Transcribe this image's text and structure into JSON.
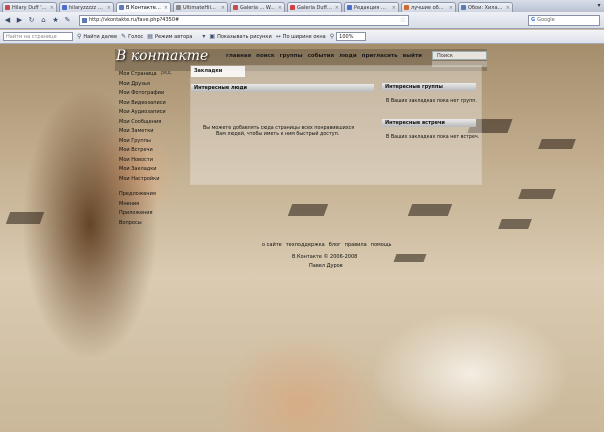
{
  "tabs": [
    {
      "label": "Hilary Duff '11...",
      "favicon_color": "#c84b4b",
      "active": false
    },
    {
      "label": "hilaryzzzzz 5t...",
      "favicon_color": "#4b6fc8",
      "active": false
    },
    {
      "label": "В Контакте | З...",
      "favicon_color": "#5a7bb5",
      "active": true
    },
    {
      "label": "UltimateHilary...",
      "favicon_color": "#8a8a8a",
      "active": false
    },
    {
      "label": "Galeria ... W...",
      "favicon_color": "#c84b4b",
      "active": false
    },
    {
      "label": "Galeria Duff ...",
      "favicon_color": "#d04040",
      "active": false
    },
    {
      "label": "Редакция Фот...",
      "favicon_color": "#4b6fc8",
      "active": false
    },
    {
      "label": "лучшие обои ...",
      "favicon_color": "#d06a2a",
      "active": false
    },
    {
      "label": "Обои: Хилар...",
      "favicon_color": "#5a7bb5",
      "active": false
    }
  ],
  "navbar": {
    "url": "http://vkontakte.ru/fave.php?4350#",
    "search_placeholder": "Google"
  },
  "findbar": {
    "placeholder": "Найти на странице",
    "find_label": "Найти далее",
    "voice_label": "Голос",
    "author_mode_label": "Режим автора",
    "show_images_label": "Показывать рисунки",
    "fit_width_label": "По ширине окна",
    "zoom_value": "100%"
  },
  "vk": {
    "logo": "В контакте",
    "topnav": [
      "главная",
      "поиск",
      "группы",
      "события",
      "люди",
      "пригласить",
      "выйти"
    ],
    "search_placeholder": "Поиск",
    "first_item_extra": "ред.",
    "menu": [
      "Моя Страница",
      "Мои Друзья",
      "Мои Фотографии",
      "Мои Видеозаписи",
      "Мои Аудиозаписи",
      "Мои Сообщения",
      "Мои Заметки",
      "Мои Группы",
      "Мои Встречи",
      "Мои Новости",
      "Мои Закладки",
      "Мои Настройки"
    ],
    "menu2": [
      "Предложения",
      "Мнения",
      "Приложения",
      "Вопросы"
    ],
    "tab_label": "Закладки",
    "people_header": "Интересные люди",
    "people_text_1": "Вы можете добавлять сюда страницы всех понравившихся",
    "people_text_2": "Вам людей, чтобы иметь к ним быстрый доступ.",
    "groups_header": "Интересные группы",
    "groups_text": "В Ваших закладках пока нет групп.",
    "events_header": "Интересные встречи",
    "events_text": "В Ваших закладках пока нет встреч.",
    "footer_links": [
      "о сайте",
      "техподдержка",
      "блог",
      "правила",
      "помощь"
    ],
    "copyright": "В Контакте © 2006-2008",
    "author": "Павел Дуров"
  }
}
